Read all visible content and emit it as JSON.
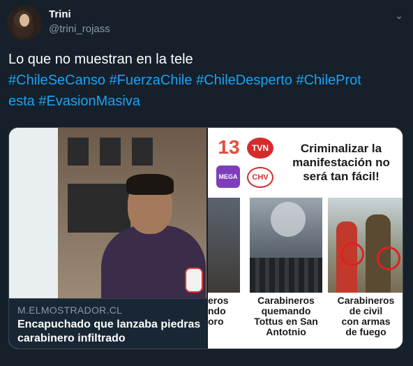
{
  "author": {
    "display_name": "Trini",
    "handle": "@trini_rojass"
  },
  "menu_icon": "chevron-down-icon",
  "tweet": {
    "text_line1": "Lo que no muestran en la tele",
    "hashtags_line2": [
      "#ChileSeCanso",
      "#FuerzaChile",
      "#ChileDesperto",
      "#ChileProt"
    ],
    "hashtags_line3": [
      "esta",
      "#EvasionMasiva"
    ]
  },
  "card": {
    "domain": "M.ELMOSTRADOR.CL",
    "title": "Encapuchado que lanzaba piedras",
    "title_line2": "carabinero infiltrado"
  },
  "collage": {
    "logos": {
      "logo_13": "13",
      "logo_tvn": "TVN",
      "logo_mega": "MEGA",
      "logo_chv": "CHV"
    },
    "headline": [
      "Criminalizar la",
      "manifestación no",
      "será tan fácil!"
    ],
    "captions": {
      "c1": [
        "eros",
        "ndo",
        "oro"
      ],
      "c2": [
        "Carabineros",
        "quemando",
        "Tottus en San",
        "Antotnio"
      ],
      "c3": [
        "Carabineros",
        "de civil",
        "con armas",
        "de fuego"
      ]
    }
  },
  "colors": {
    "background": "#15202b",
    "hashtag": "#1da1f2",
    "secondary_text": "#8899a6"
  }
}
